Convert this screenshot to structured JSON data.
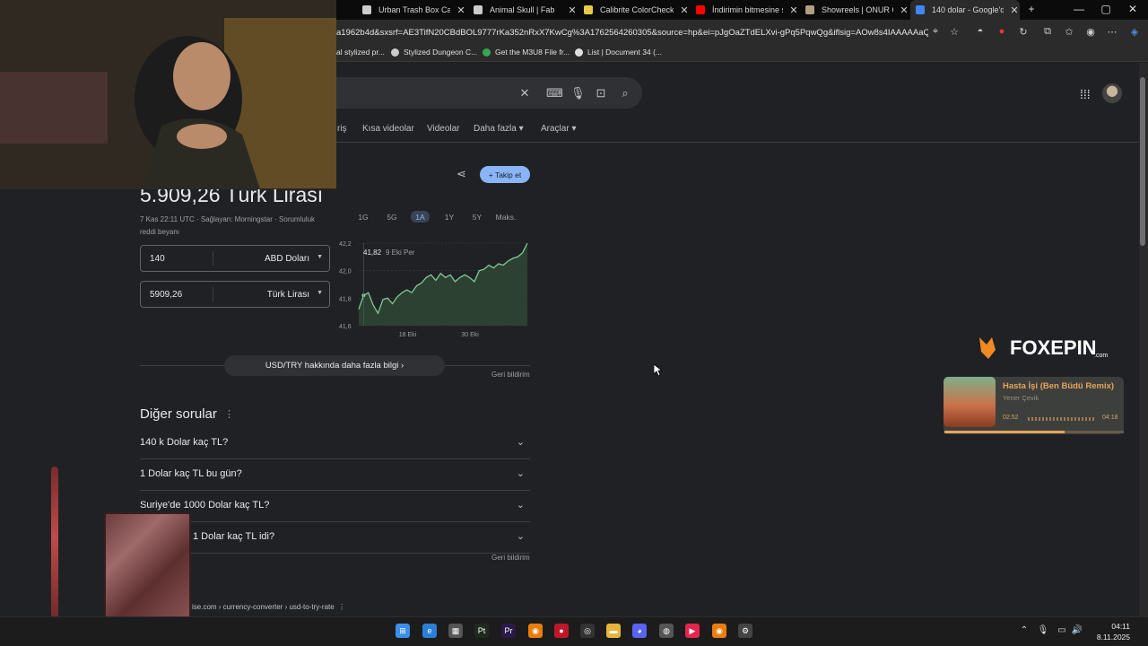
{
  "tabs": [
    {
      "label": "Urban Trash Box Cardb",
      "icon": "link-icon",
      "color": "#cccccc",
      "active": false
    },
    {
      "label": "Animal Skull | Fab",
      "icon": "link-icon",
      "color": "#cccccc",
      "active": false
    },
    {
      "label": "Calibrite ColorChecker",
      "icon": "loading-icon",
      "color": "#e8c84a",
      "active": false
    },
    {
      "label": "İndirimin bitmesine sa",
      "icon": "youtube-icon",
      "color": "#ff0000",
      "active": false
    },
    {
      "label": "Showreels | ONUR CAN",
      "icon": "site-icon",
      "color": "#b0a080",
      "active": false
    },
    {
      "label": "140 dolar - Google'da",
      "icon": "google-icon",
      "color": "#4285f4",
      "active": true
    }
  ],
  "window_controls": {
    "new_tab": "+",
    "minimize": "—",
    "maximize": "▢",
    "close": "✕"
  },
  "address": {
    "url": "a1962b4d&sxsrf=AE3TifN20CBdBOL9777rKa352nRxX7KwCg%3A1762564260305&source=hp&ei=pJgOaZTdELXvi-gPq5PqwQg&iflsig=AOw8s4IAAAAAaQ6mt..."
  },
  "bookmarks": [
    {
      "label": "al stylized pr...",
      "icon": "none",
      "color": "transparent"
    },
    {
      "label": "Stylized Dungeon C...",
      "icon": "link-icon",
      "color": "#cccccc"
    },
    {
      "label": "Get the M3U8 File fr...",
      "icon": "check-icon",
      "color": "#34a853"
    },
    {
      "label": "List | Document 34 (...",
      "icon": "doc-icon",
      "color": "#e0e0e0"
    }
  ],
  "search": {
    "nav_tabs": [
      "riş",
      "Kısa videolar",
      "Videolar",
      "Daha fazla ▾",
      "Araçlar ▾"
    ]
  },
  "converter": {
    "result": "5.909,26 Türk Lirası",
    "meta": "7 Kas 22:11 UTC · Sağlayan: Morningstar · Sorumluluk reddi beyanı",
    "from_value": "140",
    "from_currency": "ABD Doları",
    "to_value": "5909,26",
    "to_currency": "Türk Lirası",
    "follow_label": "+ Takip et",
    "ranges": [
      "1G",
      "5G",
      "1A",
      "1Y",
      "5Y",
      "Maks."
    ],
    "selected_range": "1A",
    "more_info": "USD/TRY hakkında daha fazla bilgi  ›",
    "feedback": "Geri bildirim"
  },
  "chart_data": {
    "type": "area",
    "title": "",
    "xlabel": "",
    "ylabel": "",
    "ylim": [
      41.6,
      42.2
    ],
    "yticks": [
      "42,2",
      "42,0",
      "41,8",
      "41,6"
    ],
    "xticks": [
      "18 Eki",
      "30 Eki"
    ],
    "tooltip_value": "41,82",
    "tooltip_date": "9 Eki Per",
    "series": [
      {
        "values": [
          41.72,
          41.82,
          41.84,
          41.75,
          41.69,
          41.79,
          41.8,
          41.76,
          41.81,
          41.84,
          41.86,
          41.84,
          41.89,
          41.91,
          41.95,
          41.97,
          41.93,
          41.98,
          41.95,
          41.97,
          41.92,
          41.95,
          41.97,
          41.95,
          41.92,
          42.0,
          42.01,
          42.04,
          42.02,
          42.05,
          42.04,
          42.07,
          42.09,
          42.1,
          42.13,
          42.2
        ]
      }
    ],
    "color": "#81c995"
  },
  "paa": {
    "title": "Diğer sorular",
    "questions": [
      "140 k Dolar kaç TL?",
      "1 Dolar kaç TL bu gün?",
      "Suriye'de 1000 Dolar kaç TL?",
      "1 Dolar kaç TL idi?"
    ],
    "feedback": "Geri bildirim"
  },
  "result": {
    "url": "ise.com › currency-converter › usd-to-try-rate"
  },
  "music": {
    "title": "Hasta İşi (Ben Büdü Remix)",
    "artist": "Yener Çevik",
    "time_current": "02:52",
    "time_total": "04:18",
    "progress": 0.67
  },
  "logo_text": "FOXEPIN",
  "logo_sub": ".com",
  "clock": {
    "time": "04:11",
    "date": "8.11.2025"
  },
  "taskbar_icons": [
    {
      "name": "windows-start-icon",
      "color": "#3b8eea",
      "glyph": "⊞"
    },
    {
      "name": "edge-icon",
      "color": "#2b7fd8",
      "glyph": "e"
    },
    {
      "name": "photos-icon",
      "color": "#555555",
      "glyph": "▦"
    },
    {
      "name": "painter-icon",
      "color": "#1e2a1e",
      "glyph": "Pt"
    },
    {
      "name": "premiere-icon",
      "color": "#2a1a4a",
      "glyph": "Pr"
    },
    {
      "name": "blender-icon",
      "color": "#e87d0d",
      "glyph": "◉"
    },
    {
      "name": "record-icon",
      "color": "#c0182a",
      "glyph": "●"
    },
    {
      "name": "obs-icon",
      "color": "#333333",
      "glyph": "◎"
    },
    {
      "name": "file-explorer-icon",
      "color": "#e8b43a",
      "glyph": "▬"
    },
    {
      "name": "discord-icon",
      "color": "#5865f2",
      "glyph": "◕"
    },
    {
      "name": "chrome-icon",
      "color": "#555555",
      "glyph": "◍"
    },
    {
      "name": "media-player-icon",
      "color": "#e5254c",
      "glyph": "▶"
    },
    {
      "name": "blender2-icon",
      "color": "#e87d0d",
      "glyph": "◉"
    },
    {
      "name": "settings-gear-icon",
      "color": "#444444",
      "glyph": "⚙"
    }
  ]
}
